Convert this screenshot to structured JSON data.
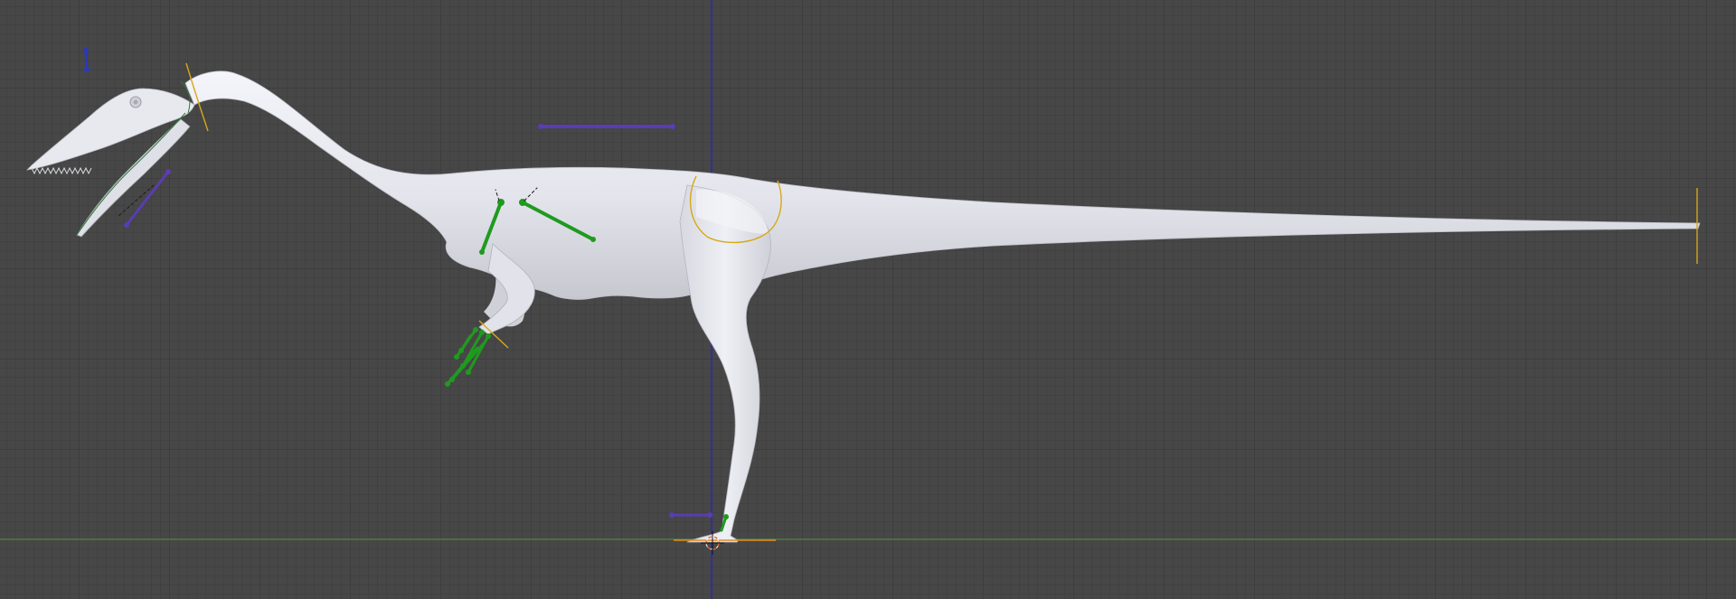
{
  "viewport": {
    "view": "side-orthographic",
    "background_color": "#474747",
    "grid_color": "#3c3c3c",
    "x_axis_color": "#5a9a3a",
    "z_axis_color": "#2a2aa8",
    "mesh_color": "#e6e7ee",
    "bone_color": "#1f9a1f",
    "bone_selected_ik_color": "#5a3cb4",
    "constraint_color": "#d6a81a",
    "cursor_color": "#e0641e",
    "object": "dinosaur-mesh",
    "armature": "dinosaur-rig"
  }
}
